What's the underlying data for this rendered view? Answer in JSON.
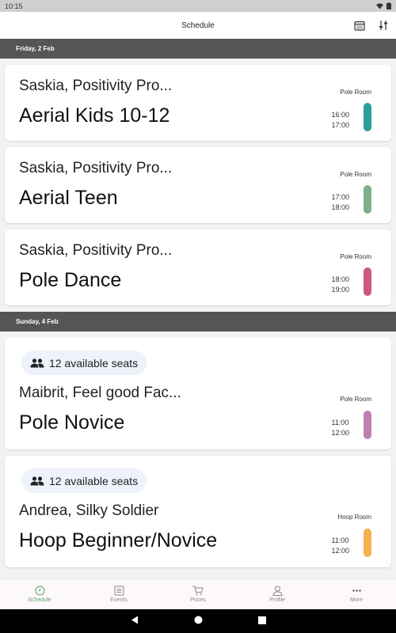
{
  "status": {
    "time": "10:15"
  },
  "appbar": {
    "title": "Schedule"
  },
  "sections": [
    {
      "date": "Friday, 2 Feb",
      "items": [
        {
          "teacher": "Saskia, Positivity Pro...",
          "name": "Aerial Kids 10-12",
          "room": "Pole Room",
          "start": "16:00",
          "end": "17:00",
          "color": "#2aa198"
        },
        {
          "teacher": "Saskia, Positivity Pro...",
          "name": "Aerial Teen",
          "room": "Pole Room",
          "start": "17:00",
          "end": "18:00",
          "color": "#7fb08c"
        },
        {
          "teacher": "Saskia, Positivity Pro...",
          "name": "Pole Dance",
          "room": "Pole Room",
          "start": "18:00",
          "end": "19:00",
          "color": "#cc5a7e"
        }
      ]
    },
    {
      "date": "Sunday, 4 Feb",
      "items": [
        {
          "seats": "12 available seats",
          "teacher": "Maibrit, Feel good Fac...",
          "name": "Pole Novice",
          "room": "Pole Room",
          "start": "11:00",
          "end": "12:00",
          "color": "#c07fb0"
        },
        {
          "seats": "12 available seats",
          "teacher": "Andrea, Silky Soldier",
          "name": "Hoop Beginner/Novice",
          "room": "Hoop Room",
          "start": "11:00",
          "end": "12:00",
          "color": "#f6b04e"
        }
      ]
    }
  ],
  "nav": [
    {
      "label": "Schedule",
      "icon": "clock-icon",
      "active": true
    },
    {
      "label": "Events",
      "icon": "calendar-list-icon"
    },
    {
      "label": "Prices",
      "icon": "cart-icon"
    },
    {
      "label": "Profile",
      "icon": "person-icon"
    },
    {
      "label": "More",
      "icon": "more-dots-icon"
    }
  ]
}
